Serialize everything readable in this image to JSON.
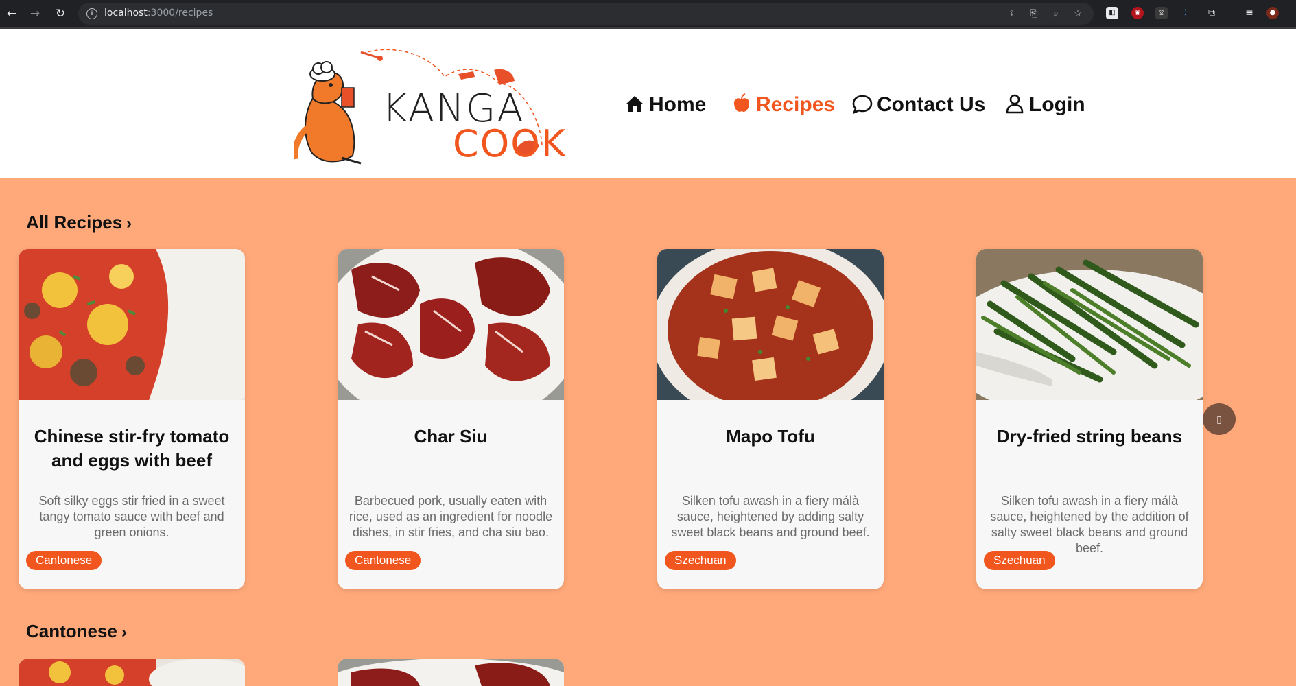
{
  "browser": {
    "url_host": "localhost",
    "url_rest": ":3000/recipes"
  },
  "site": {
    "logo_word_1": "KANGA",
    "logo_word_2": "COOK",
    "nav": [
      {
        "label": "Home",
        "icon": "home-icon",
        "active": false
      },
      {
        "label": "Recipes",
        "icon": "apple-icon",
        "active": true
      },
      {
        "label": "Contact Us",
        "icon": "chat-bubble-icon",
        "active": false
      },
      {
        "label": "Login",
        "icon": "user-icon",
        "active": false
      }
    ]
  },
  "colors": {
    "accent": "#f0561d",
    "page_background": "#ffa97a",
    "card_background": "#f7f7f7"
  },
  "sections": [
    {
      "title": "All Recipes",
      "cards": [
        {
          "title": "Chinese stir-fry tomato and eggs with beef",
          "description": "Soft silky eggs stir fried in a sweet tangy tomato sauce with beef and green onions.",
          "tag": "Cantonese",
          "image": "tomato-egg-beef-photo"
        },
        {
          "title": "Char Siu",
          "description": "Barbecued pork, usually eaten with rice, used as an ingredient for noodle dishes, in stir fries, and cha siu bao.",
          "tag": "Cantonese",
          "image": "char-siu-photo"
        },
        {
          "title": "Mapo Tofu",
          "description": "Silken tofu awash in a fiery málà sauce, heightened by adding salty sweet black beans and ground beef.",
          "tag": "Szechuan",
          "image": "mapo-tofu-photo"
        },
        {
          "title": "Dry-fried string beans",
          "description": "Silken tofu awash in a fiery málà sauce, heightened by the addition of salty sweet black beans and ground beef.",
          "tag": "Szechuan",
          "image": "string-beans-photo"
        }
      ]
    },
    {
      "title": "Cantonese",
      "cards": []
    }
  ],
  "fab": {
    "icon": "square-icon"
  }
}
